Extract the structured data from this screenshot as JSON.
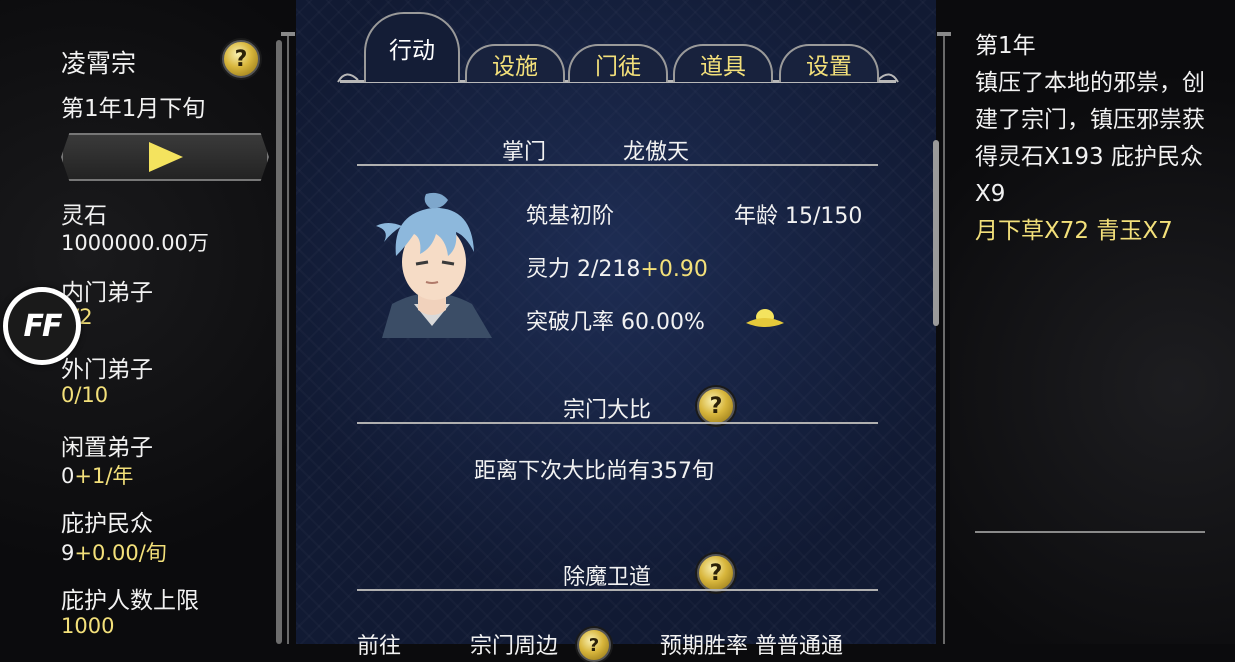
{
  "left": {
    "sect_name": "凌霄宗",
    "date": "第1年1月下旬",
    "stats": [
      {
        "label": "灵石",
        "value": "1000000.00万"
      },
      {
        "label": "内门弟子",
        "value": "?/2"
      },
      {
        "label": "外门弟子",
        "value": "0/10"
      },
      {
        "label": "闲置弟子",
        "value_base": "0",
        "value_delta": "+1/年"
      },
      {
        "label": "庇护民众",
        "value_base": "9",
        "value_delta": "+0.00/旬"
      },
      {
        "label": "庇护人数上限",
        "value": "1000"
      }
    ],
    "ff_label": "FF",
    "help_glyph": "?"
  },
  "tabs": [
    {
      "label": "行动",
      "active": true
    },
    {
      "label": "设施",
      "active": false
    },
    {
      "label": "门徒",
      "active": false
    },
    {
      "label": "道具",
      "active": false
    },
    {
      "label": "设置",
      "active": false
    }
  ],
  "leader": {
    "title_label": "掌门",
    "name": "龙傲天",
    "realm": "筑基初阶",
    "age_label": "年龄",
    "age_value": "15/150",
    "spirit_label": "灵力",
    "spirit_value": "2/218",
    "spirit_delta": "+0.90",
    "breakthrough_label": "突破几率",
    "breakthrough_value": "60.00%"
  },
  "tournament": {
    "heading": "宗门大比",
    "text": "距离下次大比尚有357旬"
  },
  "demon": {
    "heading": "除魔卫道",
    "row_partial": [
      "前往",
      "宗门周边",
      "预期胜率 普普通通"
    ]
  },
  "log": {
    "year": "第1年",
    "body": "镇压了本地的邪祟，创建了宗门，镇压邪祟获得灵石X193 庇护民众X9",
    "rewards": "月下草X72 青玉X7"
  },
  "colors": {
    "accent_gold": "#f3e07a",
    "center_bg": "#111a33",
    "side_bg": "#0b0b0d"
  }
}
